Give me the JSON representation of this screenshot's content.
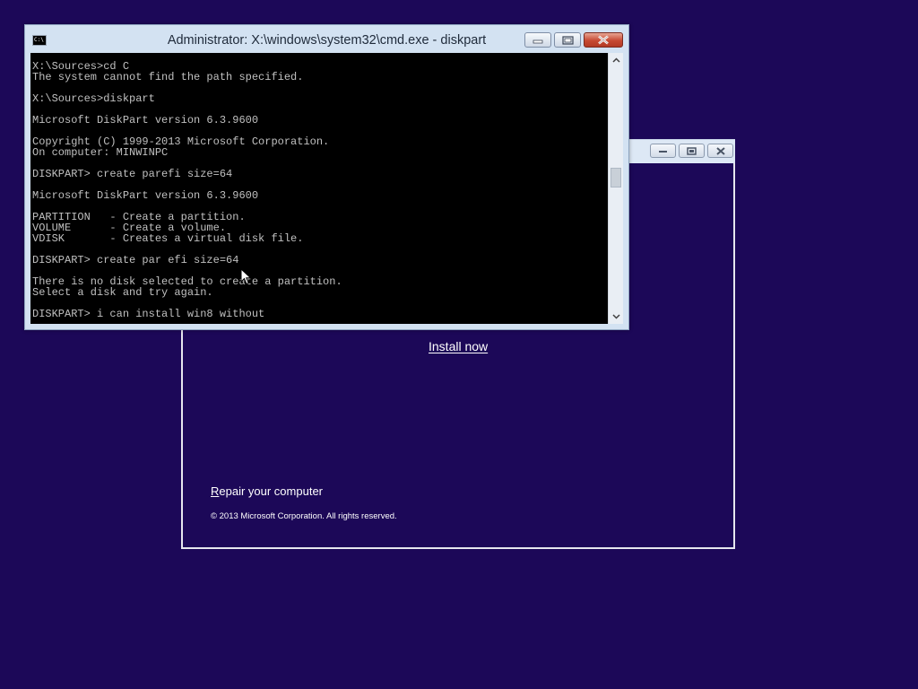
{
  "setup": {
    "install_now": "Install now",
    "repair_first_letter": "R",
    "repair_rest": "epair your computer",
    "copyright": "© 2013 Microsoft Corporation. All rights reserved."
  },
  "cmd": {
    "icon_text": "C:\\",
    "title": "Administrator: X:\\windows\\system32\\cmd.exe - diskpart",
    "lines": [
      "X:\\Sources>cd C",
      "The system cannot find the path specified.",
      "",
      "X:\\Sources>diskpart",
      "",
      "Microsoft DiskPart version 6.3.9600",
      "",
      "Copyright (C) 1999-2013 Microsoft Corporation.",
      "On computer: MINWINPC",
      "",
      "DISKPART> create parefi size=64",
      "",
      "Microsoft DiskPart version 6.3.9600",
      "",
      "PARTITION   - Create a partition.",
      "VOLUME      - Create a volume.",
      "VDISK       - Creates a virtual disk file.",
      "",
      "DISKPART> create par efi size=64",
      "",
      "There is no disk selected to create a partition.",
      "Select a disk and try again.",
      "",
      "DISKPART> i can install win8 without"
    ]
  },
  "colors": {
    "desktop": "#1c0858",
    "console_text": "#c0c0c0",
    "close_button": "#c74a33"
  }
}
